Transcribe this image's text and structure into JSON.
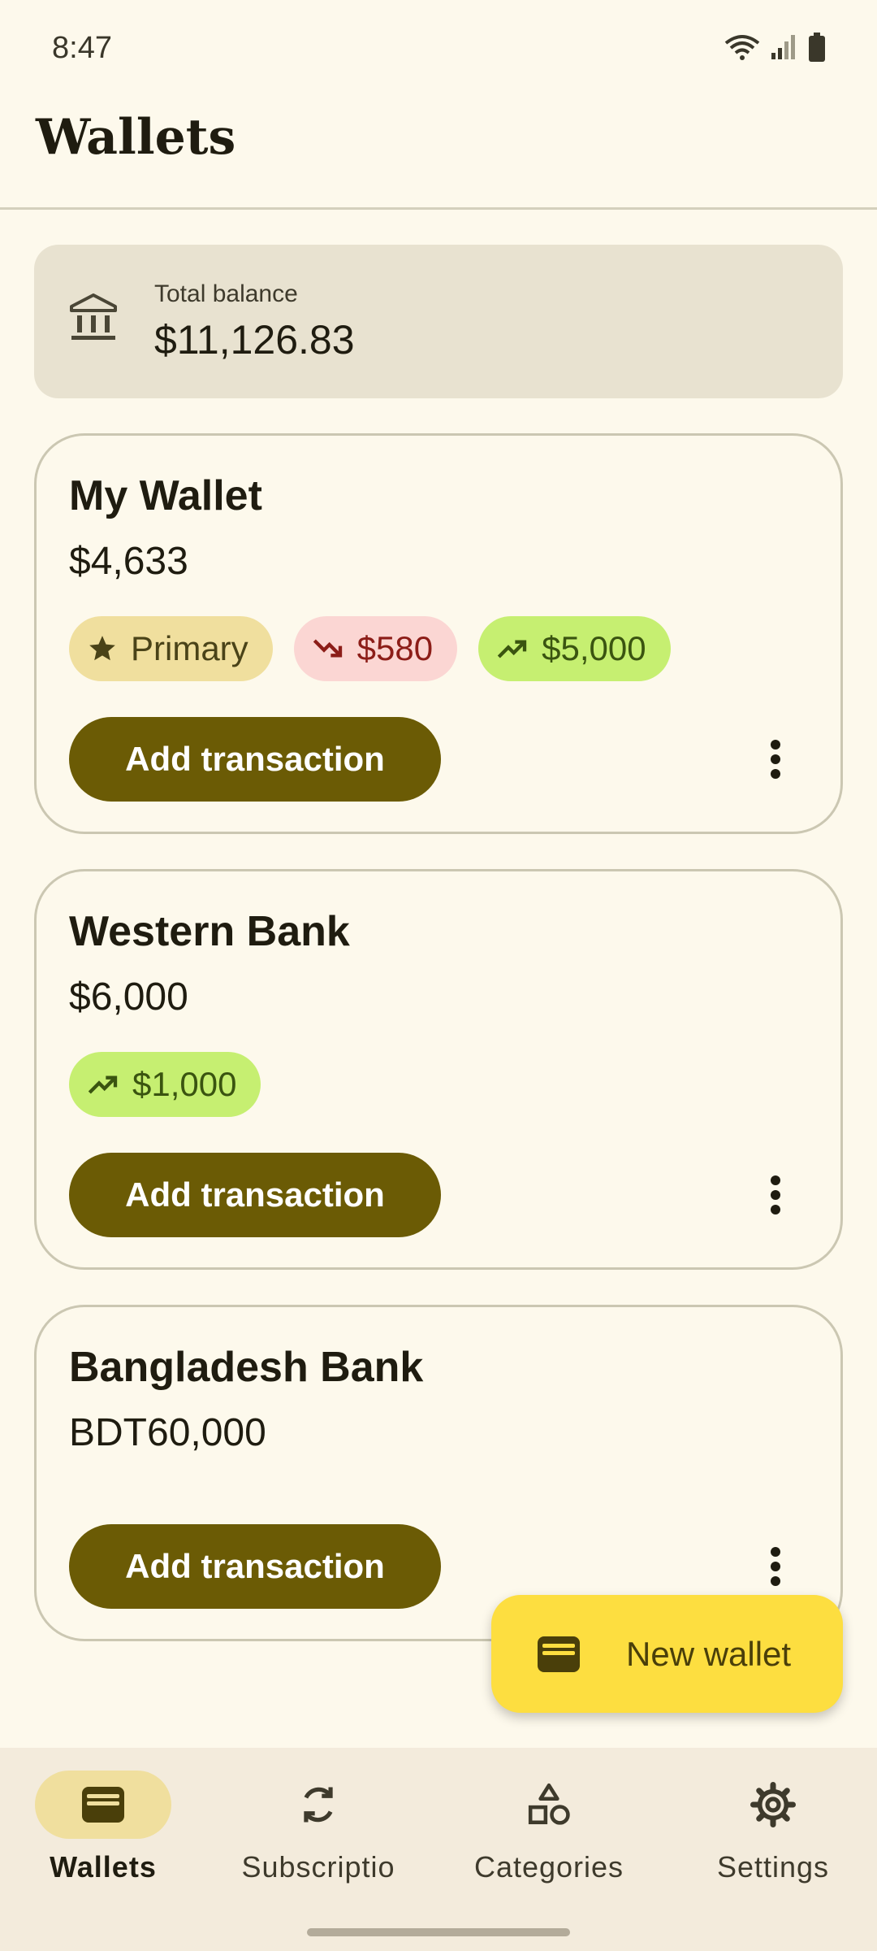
{
  "status_bar": {
    "time": "8:47"
  },
  "header": {
    "title": "Wallets"
  },
  "total": {
    "label": "Total balance",
    "value": "$11,126.83"
  },
  "wallets": [
    {
      "name": "My Wallet",
      "balance": "$4,633",
      "chips": {
        "primary": "Primary",
        "expense": "$580",
        "income": "$5,000"
      },
      "add_label": "Add transaction"
    },
    {
      "name": "Western Bank",
      "balance": "$6,000",
      "chips": {
        "income": "$1,000"
      },
      "add_label": "Add transaction"
    },
    {
      "name": "Bangladesh Bank",
      "balance": "BDT60,000",
      "add_label": "Add transaction"
    }
  ],
  "fab": {
    "label": "New wallet"
  },
  "nav": [
    {
      "label": "Wallets",
      "icon": "wallet-icon",
      "active": true
    },
    {
      "label": "Subscriptio",
      "icon": "sync-icon",
      "active": false
    },
    {
      "label": "Categories",
      "icon": "shapes-icon",
      "active": false
    },
    {
      "label": "Settings",
      "icon": "gear-icon",
      "active": false
    }
  ],
  "colors": {
    "background": "#fdf9ec",
    "primary_button": "#6b5b05",
    "fab": "#fdde40",
    "chip_primary": "#f0df9e",
    "chip_expense": "#fbd6d3",
    "chip_income": "#c6ef71"
  }
}
